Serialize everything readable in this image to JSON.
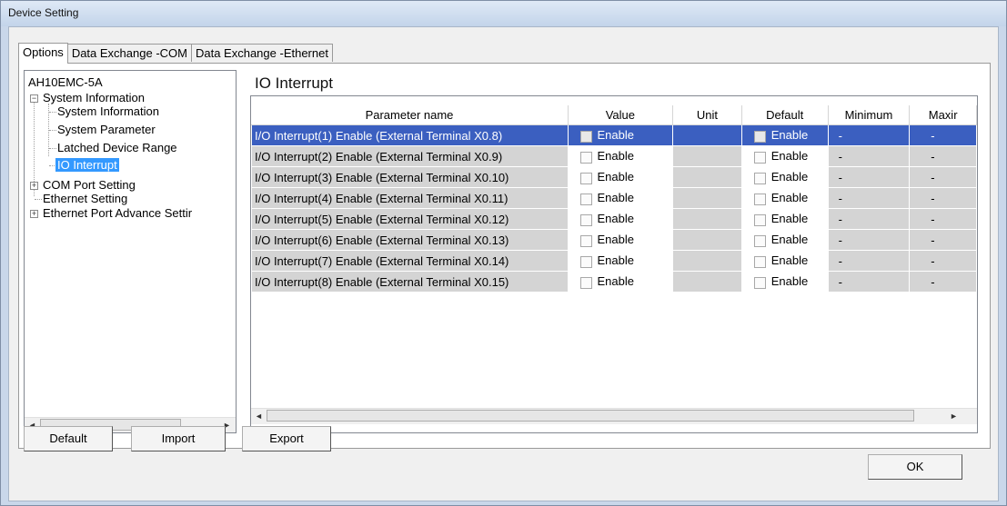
{
  "window": {
    "title": "Device Setting"
  },
  "tabs": [
    {
      "label": "Options",
      "active": true
    },
    {
      "label": "Data Exchange -COM",
      "active": false
    },
    {
      "label": "Data Exchange -Ethernet",
      "active": false
    }
  ],
  "tree": {
    "root": "AH10EMC-5A",
    "items": [
      {
        "label": "System Information",
        "expander": "−"
      },
      {
        "label": "System Information"
      },
      {
        "label": "System Parameter"
      },
      {
        "label": "Latched Device Range"
      },
      {
        "label": "IO Interrupt",
        "selected": true
      },
      {
        "label": "COM Port Setting",
        "expander": "+"
      },
      {
        "label": "Ethernet Setting"
      },
      {
        "label": "Ethernet Port Advance Settir",
        "expander": "+"
      }
    ]
  },
  "panel": {
    "title": "IO Interrupt"
  },
  "grid": {
    "columns": [
      "Parameter name",
      "Value",
      "Unit",
      "Default",
      "Minimum",
      "Maxir"
    ],
    "rows": [
      {
        "name": "I/O Interrupt(1) Enable (External Terminal X0.8)",
        "value": "Enable",
        "unit": "",
        "default": "Enable",
        "min": "-",
        "max": "-"
      },
      {
        "name": "I/O Interrupt(2) Enable (External Terminal X0.9)",
        "value": "Enable",
        "unit": "",
        "default": "Enable",
        "min": "-",
        "max": "-"
      },
      {
        "name": "I/O Interrupt(3) Enable (External Terminal X0.10)",
        "value": "Enable",
        "unit": "",
        "default": "Enable",
        "min": "-",
        "max": "-"
      },
      {
        "name": "I/O Interrupt(4) Enable (External Terminal X0.11)",
        "value": "Enable",
        "unit": "",
        "default": "Enable",
        "min": "-",
        "max": "-"
      },
      {
        "name": "I/O Interrupt(5) Enable (External Terminal X0.12)",
        "value": "Enable",
        "unit": "",
        "default": "Enable",
        "min": "-",
        "max": "-"
      },
      {
        "name": "I/O Interrupt(6) Enable (External Terminal X0.13)",
        "value": "Enable",
        "unit": "",
        "default": "Enable",
        "min": "-",
        "max": "-"
      },
      {
        "name": "I/O Interrupt(7) Enable (External Terminal X0.14)",
        "value": "Enable",
        "unit": "",
        "default": "Enable",
        "min": "-",
        "max": "-"
      },
      {
        "name": "I/O Interrupt(8) Enable (External Terminal X0.15)",
        "value": "Enable",
        "unit": "",
        "default": "Enable",
        "min": "-",
        "max": "-"
      }
    ]
  },
  "buttons": {
    "default": "Default",
    "import": "Import",
    "export": "Export",
    "ok": "OK"
  },
  "icons": {
    "scroll_left": "◄",
    "scroll_right": "►"
  },
  "colors": {
    "selection": "#3399ff",
    "grid_selected_row": "#3b5fc0",
    "readonly_cell": "#d4d4d4"
  }
}
